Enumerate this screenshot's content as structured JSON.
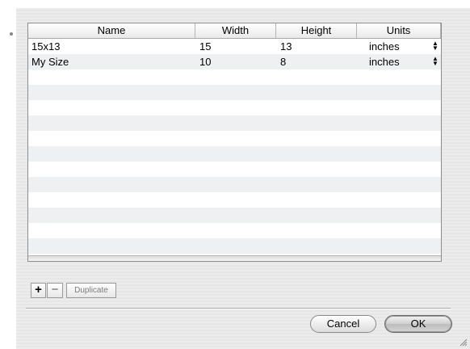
{
  "table": {
    "columns": [
      "Name",
      "Width",
      "Height",
      "Units"
    ],
    "rows": [
      [
        "15x13",
        "15",
        "13",
        "inches"
      ],
      [
        "My Size",
        "10",
        "8",
        "inches"
      ]
    ]
  },
  "buttons": {
    "add": "+",
    "remove": "−",
    "duplicate": "Duplicate",
    "cancel": "Cancel",
    "ok": "OK"
  },
  "icons": {
    "stepper": "up-down-arrows-icon",
    "resize": "resize-grip-icon"
  }
}
